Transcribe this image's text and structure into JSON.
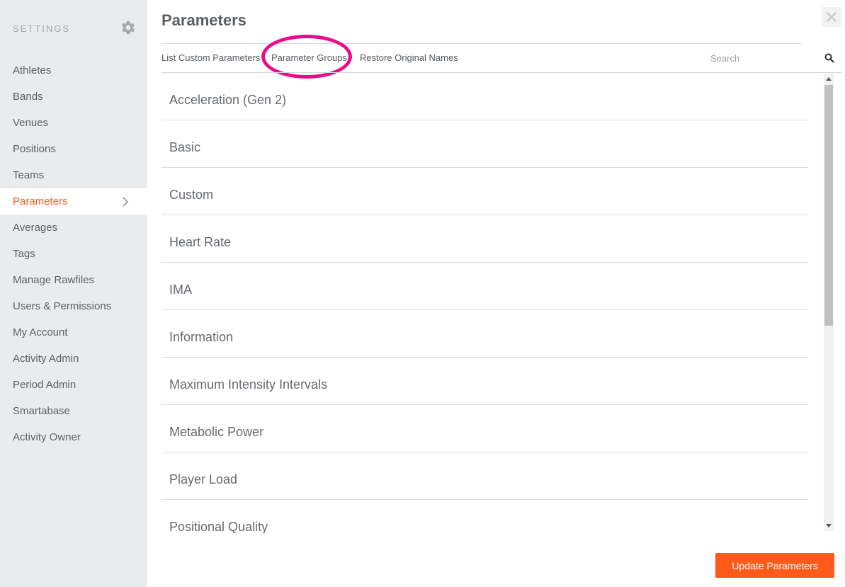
{
  "sidebar": {
    "title": "SETTINGS",
    "settings_icon": "gear-icon",
    "items": [
      {
        "label": "Athletes"
      },
      {
        "label": "Bands"
      },
      {
        "label": "Venues"
      },
      {
        "label": "Positions"
      },
      {
        "label": "Teams"
      },
      {
        "label": "Parameters",
        "active": true
      },
      {
        "label": "Averages"
      },
      {
        "label": "Tags"
      },
      {
        "label": "Manage Rawfiles"
      },
      {
        "label": "Users & Permissions"
      },
      {
        "label": "My Account"
      },
      {
        "label": "Activity Admin"
      },
      {
        "label": "Period Admin"
      },
      {
        "label": "Smartabase"
      },
      {
        "label": "Activity Owner"
      }
    ],
    "active_color": "#ff5a1f"
  },
  "main": {
    "title": "Parameters",
    "tabs": [
      {
        "label": "List Custom Parameters"
      },
      {
        "label": "Parameter Groups",
        "highlighted": true
      },
      {
        "label": "Restore Original Names"
      }
    ],
    "search": {
      "placeholder": "Search",
      "value": ""
    },
    "groups": [
      "Acceleration (Gen 2)",
      "Basic",
      "Custom",
      "Heart Rate",
      "IMA",
      "Information",
      "Maximum Intensity Intervals",
      "Metabolic Power",
      "Player Load",
      "Positional Quality"
    ],
    "update_button": "Update Parameters"
  },
  "colors": {
    "accent": "#ff5a1a",
    "highlight_ring": "#ec0c8b",
    "sidebar_bg": "#eaebed"
  }
}
